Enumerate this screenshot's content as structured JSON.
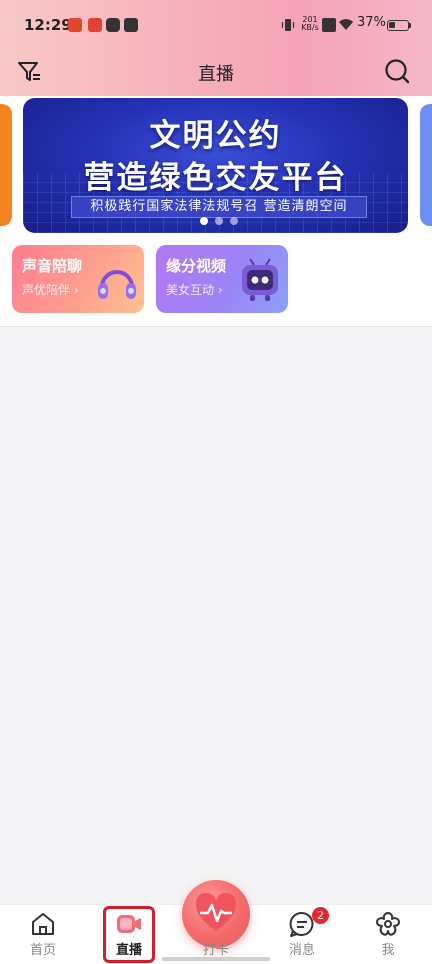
{
  "status_bar": {
    "time": "12:29",
    "net_speed_top": "201",
    "net_speed_bottom": "KB/s",
    "battery": "37%",
    "battery_level": 0.37
  },
  "header": {
    "title": "直播",
    "filter_icon": "filter-icon",
    "search_icon": "search-icon"
  },
  "banner": {
    "line1": "文明公约",
    "line2": "营造绿色交友平台",
    "subtitle": "积极践行国家法律法规号召 营造清朗空间",
    "page_count": 3,
    "active_index": 0
  },
  "cards": [
    {
      "title": "声音陪聊",
      "subtitle": "声优陪伴 ›",
      "icon": "headphones-icon",
      "color": "#ff8a8f"
    },
    {
      "title": "缘分视频",
      "subtitle": "美女互动 ›",
      "icon": "tv-mascot-icon",
      "color": "#a57ef5"
    }
  ],
  "tabbar": {
    "items": [
      {
        "label": "首页",
        "icon": "home-icon"
      },
      {
        "label": "直播",
        "icon": "live-camera-icon",
        "active": true
      },
      {
        "label": "打卡",
        "icon": "heart-pulse-icon"
      },
      {
        "label": "消息",
        "icon": "chat-icon",
        "badge": "2"
      },
      {
        "label": "我",
        "icon": "profile-flower-icon"
      }
    ]
  },
  "colors": {
    "accent": "#f36a7a",
    "highlight_border": "#d51d2a",
    "badge": "#e8262f"
  }
}
